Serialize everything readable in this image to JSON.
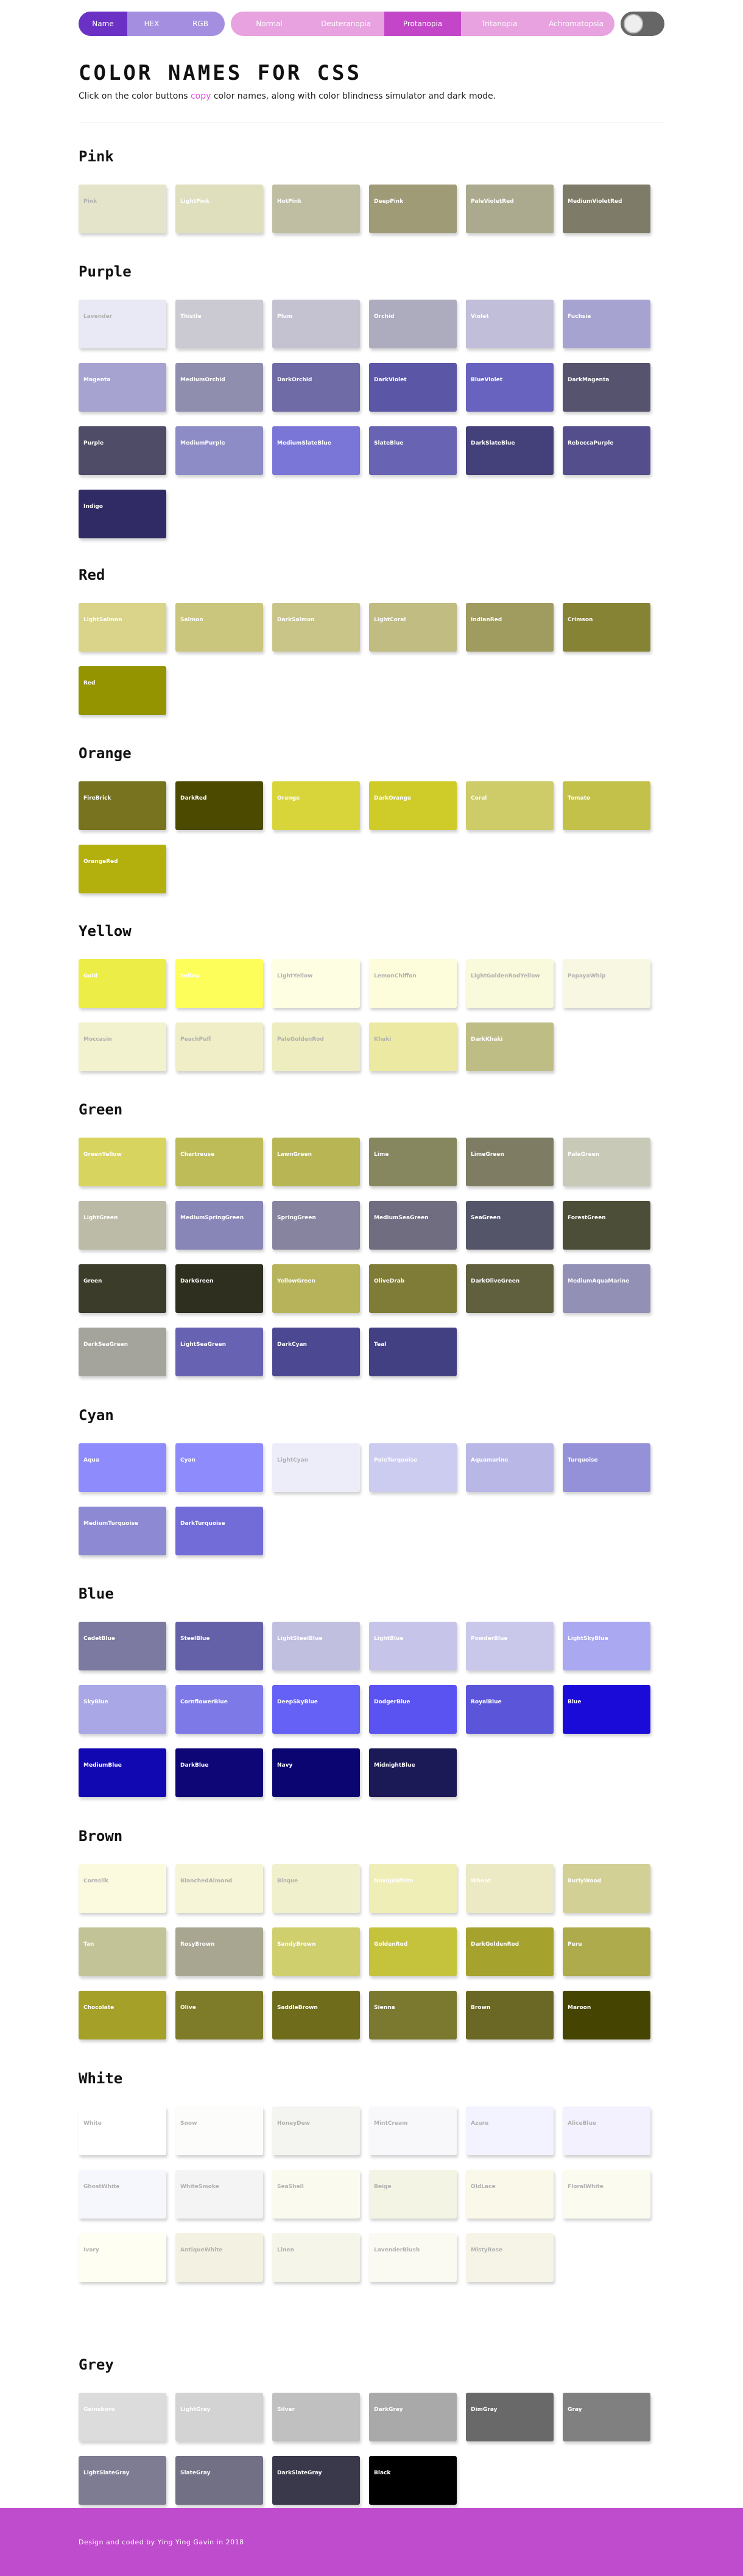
{
  "nav": {
    "modes": [
      {
        "label": "Name",
        "active": true
      },
      {
        "label": "HEX",
        "active": false
      },
      {
        "label": "RGB",
        "active": false
      }
    ],
    "simulators": [
      {
        "label": "Normal",
        "active": false
      },
      {
        "label": "Deuteranopia",
        "active": false
      },
      {
        "label": "Protanopia",
        "active": true
      },
      {
        "label": "Tritanopia",
        "active": false
      },
      {
        "label": "Achromatopsia",
        "active": false
      }
    ]
  },
  "header": {
    "title": "COLOR NAMES FOR CSS",
    "subtitle_before": "Click on the color buttons ",
    "subtitle_accent": "copy",
    "subtitle_after": " color names, along with color blindness simulator and dark mode."
  },
  "footer": {
    "text": "Design and coded by Ying Ying Gavin in 2018"
  },
  "colors": {
    "light_text": "#ffffff",
    "dark_text": "#b0b0b0",
    "accent": "#bf4bcd"
  },
  "sections": [
    {
      "title": "Pink",
      "swatches": [
        {
          "name": "Pink",
          "color": "#e4e4ca",
          "dark": true
        },
        {
          "name": "LightPink",
          "color": "#dfdfbe",
          "dark": false
        },
        {
          "name": "HotPink",
          "color": "#bfbea2",
          "dark": false
        },
        {
          "name": "DeepPink",
          "color": "#9f9b77",
          "dark": false
        },
        {
          "name": "PaleVioletRed",
          "color": "#acaa8e",
          "dark": false
        },
        {
          "name": "MediumVioletRed",
          "color": "#7e7c68",
          "dark": false
        }
      ]
    },
    {
      "title": "Purple",
      "swatches": [
        {
          "name": "Lavender",
          "color": "#e9e8f5",
          "dark": true
        },
        {
          "name": "Thistle",
          "color": "#cbcad3",
          "dark": false
        },
        {
          "name": "Plum",
          "color": "#c4c2d1",
          "dark": false
        },
        {
          "name": "Orchid",
          "color": "#adacbf",
          "dark": false
        },
        {
          "name": "Violet",
          "color": "#c0bed8",
          "dark": false
        },
        {
          "name": "Fuchsia",
          "color": "#a6a3d0",
          "dark": false
        },
        {
          "name": "Magenta",
          "color": "#a6a3d0",
          "dark": false
        },
        {
          "name": "MediumOrchid",
          "color": "#908eae",
          "dark": false
        },
        {
          "name": "DarkOrchid",
          "color": "#6f6ba7",
          "dark": false
        },
        {
          "name": "DarkViolet",
          "color": "#5b56a6",
          "dark": false
        },
        {
          "name": "BlueViolet",
          "color": "#6863be",
          "dark": false
        },
        {
          "name": "DarkMagenta",
          "color": "#55536e",
          "dark": false
        },
        {
          "name": "Purple",
          "color": "#4e4c66",
          "dark": false
        },
        {
          "name": "MediumPurple",
          "color": "#8d8cc6",
          "dark": false
        },
        {
          "name": "MediumSlateBlue",
          "color": "#7a76d7",
          "dark": false
        },
        {
          "name": "SlateBlue",
          "color": "#6963b3",
          "dark": false
        },
        {
          "name": "DarkSlateBlue",
          "color": "#44407a",
          "dark": false
        },
        {
          "name": "RebeccaPurple",
          "color": "#544f8c",
          "dark": false
        },
        {
          "name": "Indigo",
          "color": "#302b64",
          "dark": false
        }
      ]
    },
    {
      "title": "Red",
      "swatches": [
        {
          "name": "LightSalmon",
          "color": "#d9d48a",
          "dark": false
        },
        {
          "name": "Salmon",
          "color": "#cbc67d",
          "dark": false
        },
        {
          "name": "DarkSalmon",
          "color": "#c9c589",
          "dark": false
        },
        {
          "name": "LightCoral",
          "color": "#c0bc82",
          "dark": false
        },
        {
          "name": "IndianRed",
          "color": "#a09b5f",
          "dark": false
        },
        {
          "name": "Crimson",
          "color": "#878335",
          "dark": false
        },
        {
          "name": "Red",
          "color": "#949300",
          "dark": false
        }
      ]
    },
    {
      "title": "Orange",
      "swatches": [
        {
          "name": "FireBrick",
          "color": "#77731f",
          "dark": false
        },
        {
          "name": "DarkRed",
          "color": "#4c4a00",
          "dark": false
        },
        {
          "name": "Orange",
          "color": "#d8d53b",
          "dark": false
        },
        {
          "name": "DarkOrange",
          "color": "#cfcc2a",
          "dark": false
        },
        {
          "name": "Coral",
          "color": "#cecb69",
          "dark": false
        },
        {
          "name": "Tomato",
          "color": "#c4c14b",
          "dark": false
        },
        {
          "name": "OrangeRed",
          "color": "#b3b00d",
          "dark": false
        }
      ]
    },
    {
      "title": "Yellow",
      "swatches": [
        {
          "name": "Gold",
          "color": "#eced46",
          "dark": false
        },
        {
          "name": "Yellow",
          "color": "#fefe5b",
          "dark": false
        },
        {
          "name": "LightYellow",
          "color": "#fefee3",
          "dark": true
        },
        {
          "name": "LemonChiffon",
          "color": "#fdfcdb",
          "dark": true
        },
        {
          "name": "LightGoldenRodYellow",
          "color": "#f9f9dc",
          "dark": true
        },
        {
          "name": "PapayaWhip",
          "color": "#f8f7e2",
          "dark": true
        },
        {
          "name": "Moccasin",
          "color": "#f3f2cf",
          "dark": true
        },
        {
          "name": "PeachPuff",
          "color": "#efeec7",
          "dark": true
        },
        {
          "name": "PaleGoldenRod",
          "color": "#ededc0",
          "dark": true
        },
        {
          "name": "Khaki",
          "color": "#eceaa2",
          "dark": true
        },
        {
          "name": "DarkKhaki",
          "color": "#bebd85",
          "dark": false
        }
      ]
    },
    {
      "title": "Green",
      "swatches": [
        {
          "name": "GreenYellow",
          "color": "#d8d460",
          "dark": false
        },
        {
          "name": "Chartreuse",
          "color": "#bebc59",
          "dark": false
        },
        {
          "name": "LawnGreen",
          "color": "#b8b654",
          "dark": false
        },
        {
          "name": "Lime",
          "color": "#87875f",
          "dark": false
        },
        {
          "name": "LimeGreen",
          "color": "#7e7d63",
          "dark": false
        },
        {
          "name": "PaleGreen",
          "color": "#c9c9b7",
          "dark": false
        },
        {
          "name": "LightGreen",
          "color": "#bbbba7",
          "dark": false
        },
        {
          "name": "MediumSpringGreen",
          "color": "#8886b7",
          "dark": false
        },
        {
          "name": "SpringGreen",
          "color": "#86849f",
          "dark": false
        },
        {
          "name": "MediumSeaGreen",
          "color": "#6f6d7f",
          "dark": false
        },
        {
          "name": "SeaGreen",
          "color": "#55556a",
          "dark": false
        },
        {
          "name": "ForestGreen",
          "color": "#4c4e37",
          "dark": false
        },
        {
          "name": "Green",
          "color": "#3b3c2a",
          "dark": false
        },
        {
          "name": "DarkGreen",
          "color": "#2e2f1f",
          "dark": false
        },
        {
          "name": "YellowGreen",
          "color": "#b6b35a",
          "dark": false
        },
        {
          "name": "OliveDrab",
          "color": "#7f7c38",
          "dark": false
        },
        {
          "name": "DarkOliveGreen",
          "color": "#605f3e",
          "dark": false
        },
        {
          "name": "MediumAquaMarine",
          "color": "#9290b4",
          "dark": false
        },
        {
          "name": "DarkSeaGreen",
          "color": "#a5a49c",
          "dark": false
        },
        {
          "name": "LightSeaGreen",
          "color": "#6862b2",
          "dark": false
        },
        {
          "name": "DarkCyan",
          "color": "#4c4892",
          "dark": false
        },
        {
          "name": "Teal",
          "color": "#423f82",
          "dark": false
        }
      ]
    },
    {
      "title": "Cyan",
      "swatches": [
        {
          "name": "Aqua",
          "color": "#8e8bfc",
          "dark": false
        },
        {
          "name": "Cyan",
          "color": "#8e8bfc",
          "dark": false
        },
        {
          "name": "LightCyan",
          "color": "#ededfa",
          "dark": true
        },
        {
          "name": "PaleTurquoise",
          "color": "#cccbf0",
          "dark": false
        },
        {
          "name": "Aquamarine",
          "color": "#b9b7e6",
          "dark": false
        },
        {
          "name": "Turquoise",
          "color": "#9591d9",
          "dark": false
        },
        {
          "name": "MediumTurquoise",
          "color": "#8d8ad3",
          "dark": false
        },
        {
          "name": "DarkTurquoise",
          "color": "#716cd7",
          "dark": false
        }
      ]
    },
    {
      "title": "Blue",
      "swatches": [
        {
          "name": "CadetBlue",
          "color": "#7c7aa0",
          "dark": false
        },
        {
          "name": "SteelBlue",
          "color": "#6461a8",
          "dark": false
        },
        {
          "name": "LightSteelBlue",
          "color": "#c1bfe0",
          "dark": false
        },
        {
          "name": "LightBlue",
          "color": "#c6c5e9",
          "dark": false
        },
        {
          "name": "PowderBlue",
          "color": "#c9c8eb",
          "dark": false
        },
        {
          "name": "LightSkyBlue",
          "color": "#aaa8f0",
          "dark": false
        },
        {
          "name": "SkyBlue",
          "color": "#a9a7e5",
          "dark": false
        },
        {
          "name": "CornflowerBlue",
          "color": "#7d7ae8",
          "dark": false
        },
        {
          "name": "DeepSkyBlue",
          "color": "#6560f6",
          "dark": false
        },
        {
          "name": "DodgerBlue",
          "color": "#5a53f2",
          "dark": false
        },
        {
          "name": "RoyalBlue",
          "color": "#5b56d9",
          "dark": false
        },
        {
          "name": "Blue",
          "color": "#1a0bd8",
          "dark": false
        },
        {
          "name": "MediumBlue",
          "color": "#1208b2",
          "dark": false
        },
        {
          "name": "DarkBlue",
          "color": "#0e0677",
          "dark": false
        },
        {
          "name": "Navy",
          "color": "#0b0572",
          "dark": false
        },
        {
          "name": "MidnightBlue",
          "color": "#1c1957",
          "dark": false
        }
      ]
    },
    {
      "title": "Brown",
      "swatches": [
        {
          "name": "Cornsilk",
          "color": "#fbfadf",
          "dark": true
        },
        {
          "name": "BlanchedAlmond",
          "color": "#f6f5d8",
          "dark": true
        },
        {
          "name": "Bisque",
          "color": "#f1f0cc",
          "dark": true
        },
        {
          "name": "NavajoWhite",
          "color": "#efeeb7",
          "dark": false
        },
        {
          "name": "Wheat",
          "color": "#ebeac4",
          "dark": false
        },
        {
          "name": "BurlyWood",
          "color": "#d2d094",
          "dark": false
        },
        {
          "name": "Tan",
          "color": "#c3c398",
          "dark": false
        },
        {
          "name": "RosyBrown",
          "color": "#a8a690",
          "dark": false
        },
        {
          "name": "SandyBrown",
          "color": "#d0cf6e",
          "dark": false
        },
        {
          "name": "GoldenRod",
          "color": "#c5c33c",
          "dark": false
        },
        {
          "name": "DarkGoldenRod",
          "color": "#a5a22d",
          "dark": false
        },
        {
          "name": "Peru",
          "color": "#aeab4c",
          "dark": false
        },
        {
          "name": "Chocolate",
          "color": "#a4a028",
          "dark": false
        },
        {
          "name": "Olive",
          "color": "#7e7c29",
          "dark": false
        },
        {
          "name": "SaddleBrown",
          "color": "#6f6d1c",
          "dark": false
        },
        {
          "name": "Sienna",
          "color": "#7b7930",
          "dark": false
        },
        {
          "name": "Brown",
          "color": "#6b6825",
          "dark": false
        },
        {
          "name": "Maroon",
          "color": "#454400",
          "dark": false
        }
      ]
    },
    {
      "title": "White",
      "swatches": [
        {
          "name": "White",
          "color": "#ffffff",
          "dark": true
        },
        {
          "name": "Snow",
          "color": "#fcfcfa",
          "dark": true
        },
        {
          "name": "HoneyDew",
          "color": "#f4f4f0",
          "dark": true
        },
        {
          "name": "MintCream",
          "color": "#f8f8fb",
          "dark": true
        },
        {
          "name": "Azure",
          "color": "#f3f3ff",
          "dark": true
        },
        {
          "name": "AliceBlue",
          "color": "#f2f1fd",
          "dark": true
        },
        {
          "name": "GhostWhite",
          "color": "#f6f6fd",
          "dark": true
        },
        {
          "name": "WhiteSmoke",
          "color": "#f4f4f4",
          "dark": true
        },
        {
          "name": "SeaShell",
          "color": "#fbfaee",
          "dark": true
        },
        {
          "name": "Beige",
          "color": "#f4f4e4",
          "dark": true
        },
        {
          "name": "OldLace",
          "color": "#f9f8e9",
          "dark": true
        },
        {
          "name": "FloralWhite",
          "color": "#fbfbef",
          "dark": true
        },
        {
          "name": "Ivory",
          "color": "#fefef2",
          "dark": true
        },
        {
          "name": "AntiqueWhite",
          "color": "#f3f2e2",
          "dark": true
        },
        {
          "name": "Linen",
          "color": "#f6f5ea",
          "dark": true
        },
        {
          "name": "LavenderBlush",
          "color": "#fafaf3",
          "dark": true
        },
        {
          "name": "MistyRose",
          "color": "#f5f4e6",
          "dark": true
        }
      ]
    },
    {
      "title": "Grey",
      "swatches": [
        {
          "name": "Gainsboro",
          "color": "#dcdcdc",
          "dark": false
        },
        {
          "name": "LightGray",
          "color": "#d3d3d3",
          "dark": false
        },
        {
          "name": "Silver",
          "color": "#c0c0c0",
          "dark": false
        },
        {
          "name": "DarkGray",
          "color": "#a9a9a9",
          "dark": false
        },
        {
          "name": "DimGray",
          "color": "#696969",
          "dark": false
        },
        {
          "name": "Gray",
          "color": "#808080",
          "dark": false
        },
        {
          "name": "LightSlateGray",
          "color": "#7d7c93",
          "dark": false
        },
        {
          "name": "SlateGray",
          "color": "#727085",
          "dark": false
        },
        {
          "name": "DarkSlateGray",
          "color": "#3a394b",
          "dark": false
        },
        {
          "name": "Black",
          "color": "#000000",
          "dark": false
        }
      ]
    }
  ]
}
